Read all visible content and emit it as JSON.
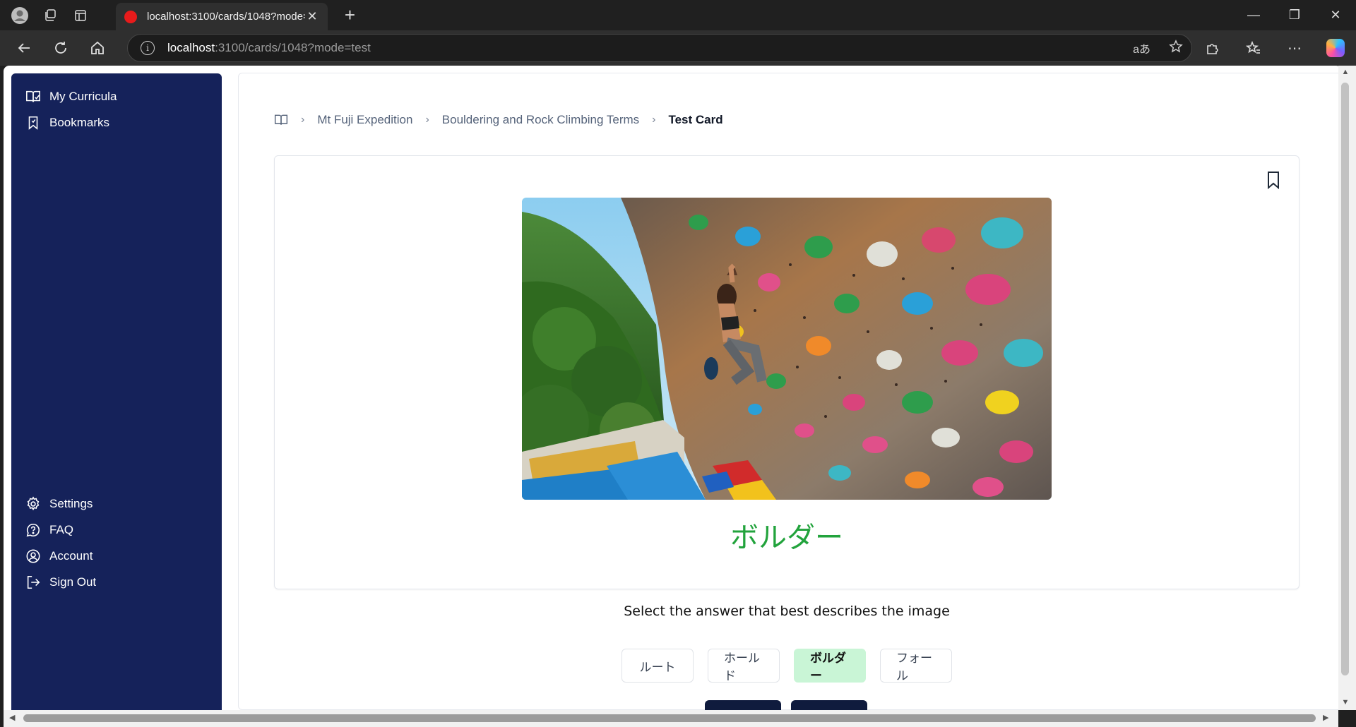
{
  "browser": {
    "tab_title": "localhost:3100/cards/1048?mode=test",
    "url_host": "localhost",
    "url_rest": ":3100/cards/1048?mode=test",
    "read_aloud_label": "aあ"
  },
  "sidebar": {
    "top_items": [
      {
        "label": "My Curricula",
        "icon": "open-book-icon"
      },
      {
        "label": "Bookmarks",
        "icon": "bookmark-icon"
      }
    ],
    "bottom_items": [
      {
        "label": "Settings",
        "icon": "gear-icon"
      },
      {
        "label": "FAQ",
        "icon": "help-bubble-icon"
      },
      {
        "label": "Account",
        "icon": "user-circle-icon"
      },
      {
        "label": "Sign Out",
        "icon": "sign-out-icon"
      }
    ]
  },
  "breadcrumb": {
    "items": [
      "Mt Fuji Expedition",
      "Bouldering and Rock Climbing Terms"
    ],
    "current": "Test Card"
  },
  "card": {
    "image_subject": "climber on a bouldering wall",
    "word": "ボルダー"
  },
  "prompt": "Select the answer that best describes the image",
  "answers": [
    {
      "label": "ルート",
      "selected": false
    },
    {
      "label": "ホールド",
      "selected": false
    },
    {
      "label": "ボルダー",
      "selected": true
    },
    {
      "label": "フォール",
      "selected": false
    }
  ],
  "colors": {
    "sidebar_bg": "#15225a",
    "word_green": "#22a33c",
    "selected_answer_bg": "#c9f5d6",
    "button_dark": "#0f1b3d"
  }
}
